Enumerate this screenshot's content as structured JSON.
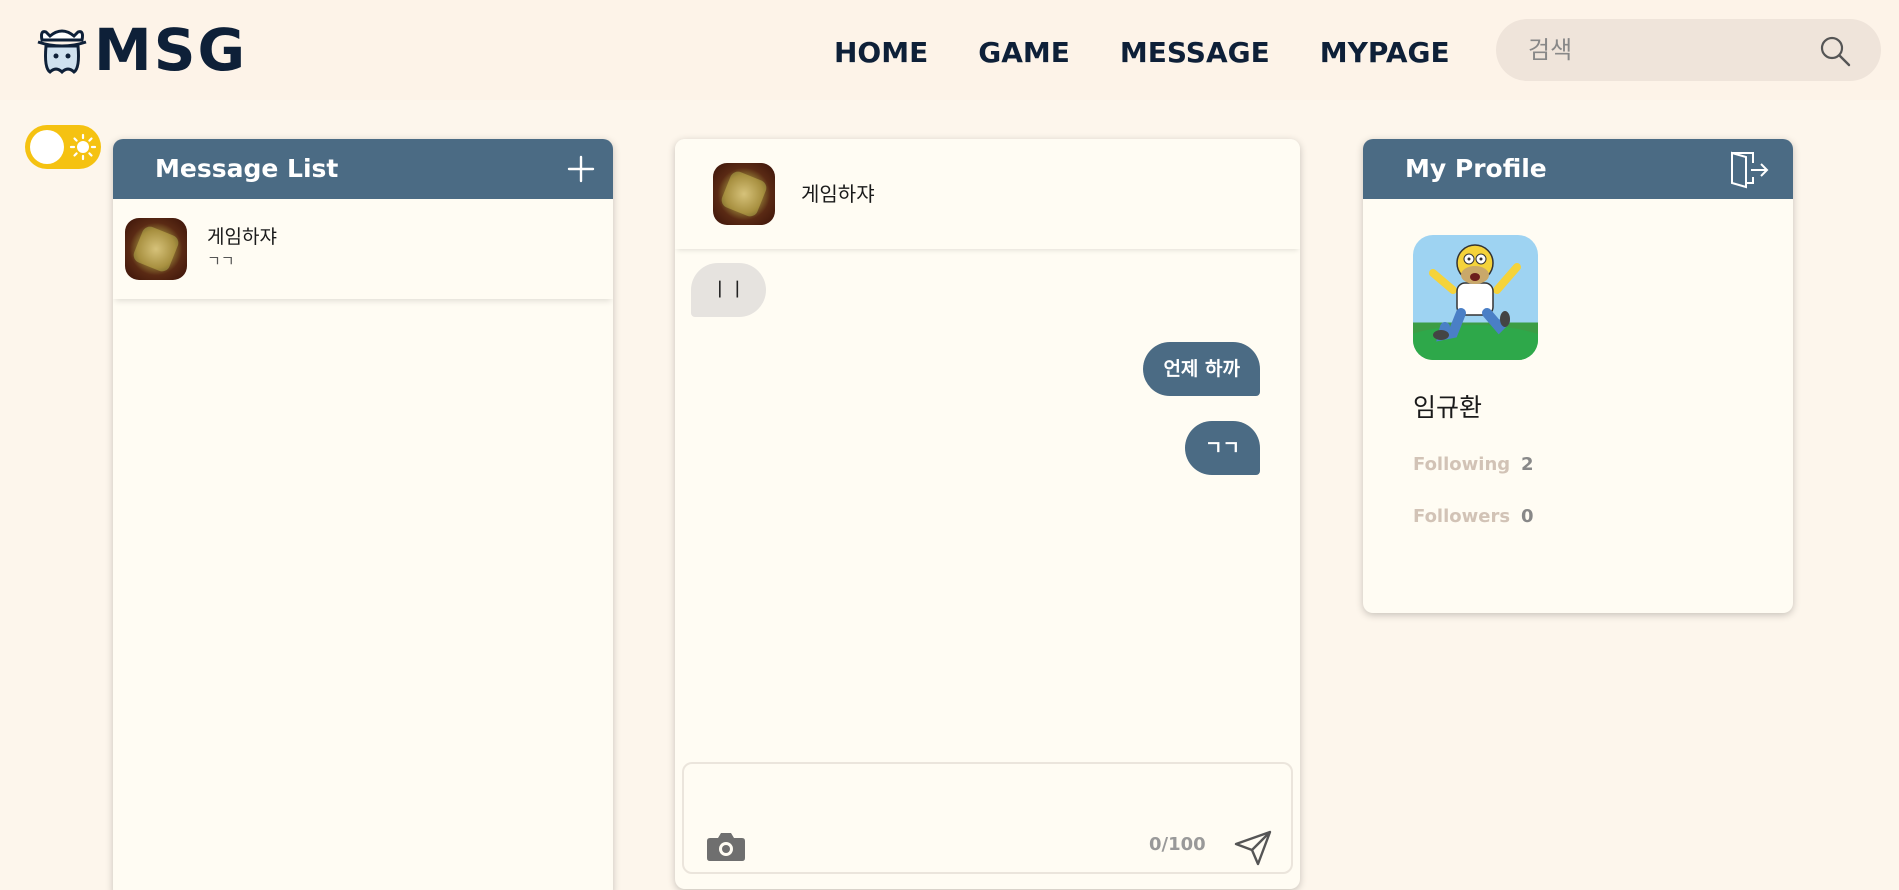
{
  "brand": {
    "logo_text": "MSG"
  },
  "nav": {
    "items": [
      {
        "label": "HOME"
      },
      {
        "label": "GAME"
      },
      {
        "label": "MESSAGE"
      },
      {
        "label": "MYPAGE"
      }
    ]
  },
  "search": {
    "placeholder": "검색",
    "value": ""
  },
  "message_list": {
    "title": "Message List",
    "items": [
      {
        "name": "게임하쟈",
        "preview": "ㄱㄱ"
      }
    ]
  },
  "chat": {
    "partner_name": "게임하쟈",
    "messages": [
      {
        "direction": "in",
        "text": "ㅣㅣ"
      },
      {
        "direction": "out",
        "text": "언제 하까"
      },
      {
        "direction": "out",
        "text": "ㄱㄱ"
      }
    ],
    "composer": {
      "value": "",
      "char_count": "0/100"
    }
  },
  "profile": {
    "title": "My Profile",
    "name": "임규환",
    "stats": [
      {
        "label": "Following",
        "value": "2"
      },
      {
        "label": "Followers",
        "value": "0"
      }
    ]
  },
  "colors": {
    "header_bg": "#fdf3e8",
    "page_bg": "#fdf6ec",
    "panel_head": "#4b6b84",
    "toggle": "#f5c211",
    "brand_navy": "#0e2038"
  },
  "icons": {
    "logo": "cowboy-hat-ghost-icon",
    "search": "search-icon",
    "theme_toggle": "sun-icon",
    "add": "plus-icon",
    "logout": "logout-icon",
    "attach": "camera-icon",
    "send": "send-icon"
  },
  "theme": {
    "mode": "light"
  }
}
